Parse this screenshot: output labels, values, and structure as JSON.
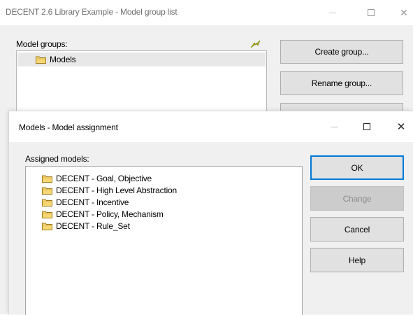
{
  "main_window": {
    "title": "DECENT 2.6 Library Example - Model group list",
    "model_groups_label": "Model groups:",
    "groups": [
      "Models"
    ],
    "buttons": {
      "create": "Create group...",
      "rename": "Rename group...",
      "third": ""
    }
  },
  "dialog": {
    "title": "Models - Model assignment",
    "assigned_label": "Assigned models:",
    "models": [
      "DECENT - Goal, Objective",
      "DECENT - High Level Abstraction",
      "DECENT - Incentive",
      "DECENT - Policy, Mechanism",
      "DECENT - Rule_Set"
    ],
    "buttons": {
      "ok": "OK",
      "change": "Change",
      "cancel": "Cancel",
      "help": "Help"
    }
  },
  "colors": {
    "folder_fill": "#f7d774",
    "folder_stroke": "#9c7a1e",
    "accent_focus": "#0078d7",
    "lightning": "#b5b800"
  },
  "icons": {
    "folder": "folder-icon",
    "lightning": "lightning-icon",
    "minimize": "minimize-icon",
    "maximize": "maximize-icon",
    "close": "close-icon"
  }
}
